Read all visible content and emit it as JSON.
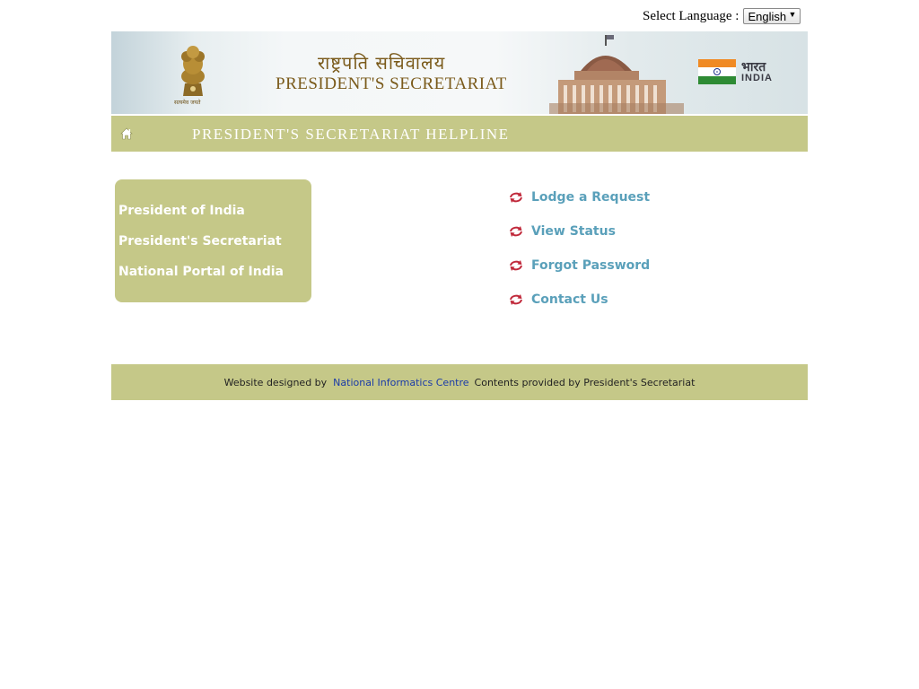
{
  "language": {
    "label": "Select Language :",
    "selected": "English"
  },
  "banner": {
    "title_hindi": "राष्ट्रपति सचिवालय",
    "title_english": "PRESIDENT'S SECRETARIAT",
    "emblem_caption": "सत्यमेव जयते",
    "india_logo_hindi": "भारत",
    "india_logo_english": "INDIA"
  },
  "helpline": {
    "title": "PRESIDENT'S SECRETARIAT HELPLINE"
  },
  "side_links": [
    {
      "label": "President of India"
    },
    {
      "label": "President's Secretariat"
    },
    {
      "label": "National Portal of India"
    }
  ],
  "actions": [
    {
      "label": "Lodge a Request"
    },
    {
      "label": "View Status"
    },
    {
      "label": "Forgot Password"
    },
    {
      "label": "Contact Us"
    }
  ],
  "footer": {
    "designed_by": "Website designed by",
    "nic": "National Informatics Centre",
    "contents": "Contents provided by President's Secretariat"
  },
  "colors": {
    "olive": "#c5c888",
    "link_blue": "#5aa0ba",
    "icon_red": "#c0283a"
  },
  "icons": {
    "home": "home-icon",
    "action": "refresh-arrows-icon"
  }
}
